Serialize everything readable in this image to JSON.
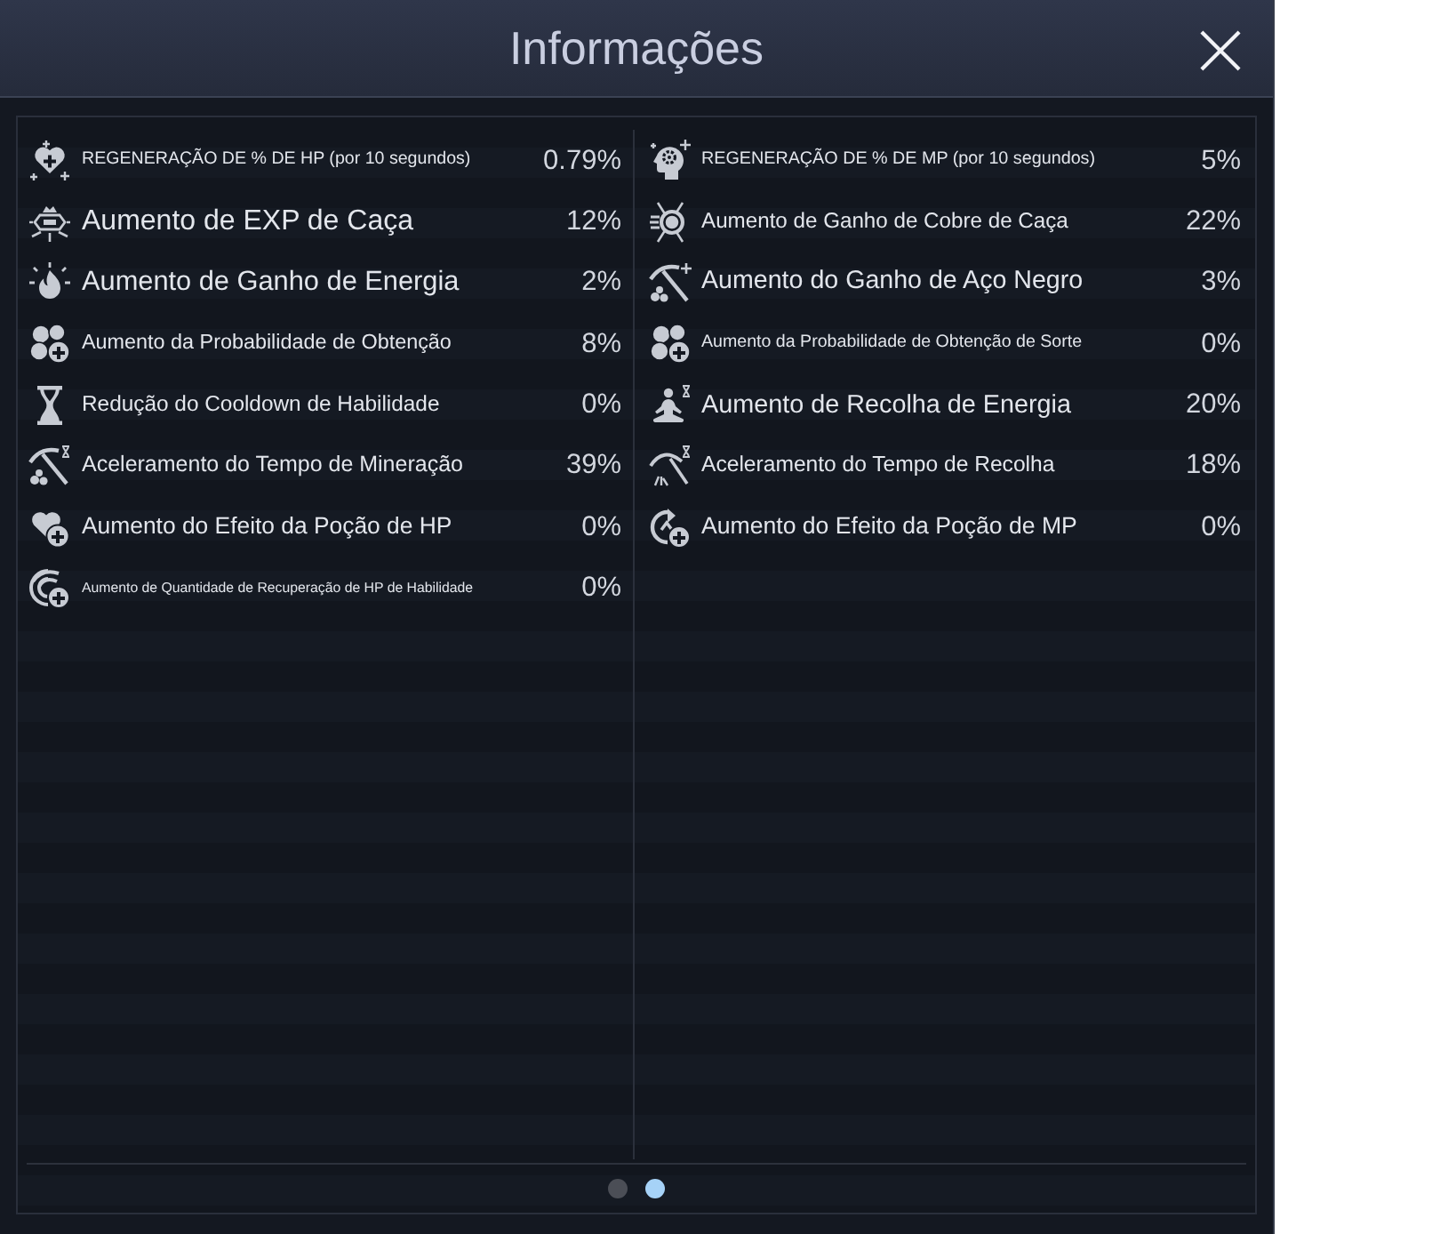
{
  "dialog": {
    "title": "Informações"
  },
  "stat_columns": [
    {
      "stats": [
        {
          "label": "REGENERAÇÃO DE % DE HP (por 10 segundos)",
          "value": "0.79%"
        },
        {
          "label": "Aumento de EXP de Caça",
          "value": "12%"
        },
        {
          "label": "Aumento de Ganho de Energia",
          "value": "2%"
        },
        {
          "label": "Aumento da Probabilidade de Obtenção",
          "value": "8%"
        },
        {
          "label": "Redução do Cooldown de Habilidade",
          "value": "0%"
        },
        {
          "label": "Aceleramento do Tempo de Mineração",
          "value": "39%"
        },
        {
          "label": "Aumento do Efeito da Poção de HP",
          "value": "0%"
        },
        {
          "label": "Aumento de Quantidade de Recuperação de HP de Habilidade",
          "value": "0%"
        }
      ]
    },
    {
      "stats": [
        {
          "label": "REGENERAÇÃO DE % DE MP (por 10 segundos)",
          "value": "5%"
        },
        {
          "label": "Aumento de Ganho de Cobre de Caça",
          "value": "22%"
        },
        {
          "label": "Aumento do Ganho de Aço Negro",
          "value": "3%"
        },
        {
          "label": "Aumento da Probabilidade de Obtenção de Sorte",
          "value": "0%"
        },
        {
          "label": "Aumento de Recolha de Energia",
          "value": "20%"
        },
        {
          "label": "Aceleramento do Tempo de Recolha",
          "value": "18%"
        },
        {
          "label": "Aumento do Efeito da Poção de MP",
          "value": "0%"
        }
      ]
    }
  ],
  "pagination": [
    {
      "selected": false
    },
    {
      "selected": true
    }
  ]
}
